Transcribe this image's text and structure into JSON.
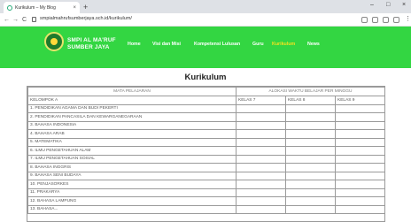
{
  "browser": {
    "tab_title": "Kurikulum – My Blog",
    "tab_close": "×",
    "new_tab": "+",
    "url": "smpialmahrufsumberjaya.sch.id/kurikulum/",
    "back": "←",
    "forward": "→",
    "reload": "C",
    "home": "⌂",
    "minimize": "–",
    "maximize": "□",
    "close": "×",
    "menu": "⋮"
  },
  "site": {
    "name_line1": "SMPI AL MA'RUF",
    "name_line2": "SUMBER JAYA",
    "nav": [
      {
        "label": "Home"
      },
      {
        "label": "Visi dan Misi"
      },
      {
        "label": "Kompetensi Lulusan"
      },
      {
        "label": "Guru"
      },
      {
        "label": "Kurikulum"
      },
      {
        "label": "News"
      }
    ]
  },
  "page": {
    "title": "Kurikulum"
  },
  "table": {
    "header_subject": "MATA PELAJARAN",
    "header_allocation": "ALOKASI WAKTU BELAJAR PER MINGGU",
    "group_label": "KELOMPOK A",
    "grades": [
      "KELAS 7",
      "KELAS 8",
      "KELAS 9"
    ],
    "subjects": [
      "1. PENDIDIKAN AGAMA DAN BUDI PEKERTI",
      "2. PENDIDIKAN PANCASILA DAN KEWARGANEGARAAN",
      "3. BAHASA INDONESIA",
      "4. BAHASA ARAB",
      "5. MATEMATIKA",
      "6. ILMU PENGETAHUAN ALAM",
      "7. ILMU PENGETAHUAN SOSIAL",
      "8. BAHASA INGGRIS",
      "9. BAHASA SENI BUDAYA",
      "10. PENJASORKES",
      "11. PRAKARYA",
      "12. BAHASA LAMPUNG",
      "13. BAHASA..."
    ]
  }
}
